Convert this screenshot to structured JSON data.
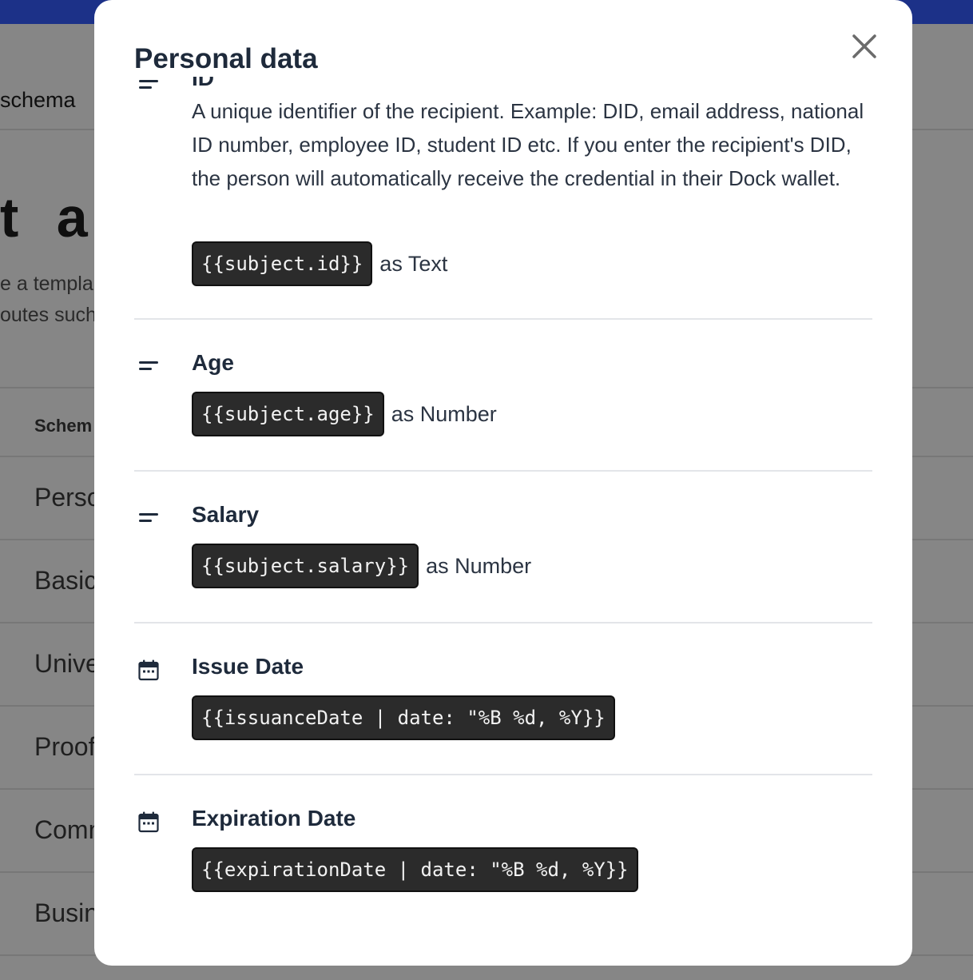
{
  "background": {
    "breadcrumb": "schema",
    "heading": "t a c",
    "description_lines": [
      "e a templa",
      "outes such"
    ],
    "table_header": "Schem",
    "rows": [
      "Perso",
      "Basic",
      "Unive",
      "Proof",
      "Comm",
      "Busin"
    ]
  },
  "modal": {
    "title": "Personal data",
    "close_label": "×",
    "fields": [
      {
        "name": "ID",
        "icon": "text-lines-icon",
        "description": "A unique identifier of the recipient. Example: DID, email address, national ID number, employee ID, student ID etc. If you enter the recipient's DID, the person will automatically receive the credential in their Dock wallet.",
        "code": "{{subject.id}}",
        "type_label": "as Text"
      },
      {
        "name": "Age",
        "icon": "text-lines-icon",
        "code": "{{subject.age}}",
        "type_label": "as Number"
      },
      {
        "name": "Salary",
        "icon": "text-lines-icon",
        "code": "{{subject.salary}}",
        "type_label": "as Number"
      },
      {
        "name": "Issue Date",
        "icon": "calendar-icon",
        "code": "{{issuanceDate | date: \"%B %d, %Y}}",
        "type_label": ""
      },
      {
        "name": "Expiration Date",
        "icon": "calendar-icon",
        "code": "{{expirationDate | date: \"%B %d, %Y}}",
        "type_label": ""
      }
    ]
  },
  "colors": {
    "topbar": "#1c3188",
    "overlay": "#868686",
    "code_bg": "#2b2b2b",
    "title_text": "#1e2a3b"
  }
}
